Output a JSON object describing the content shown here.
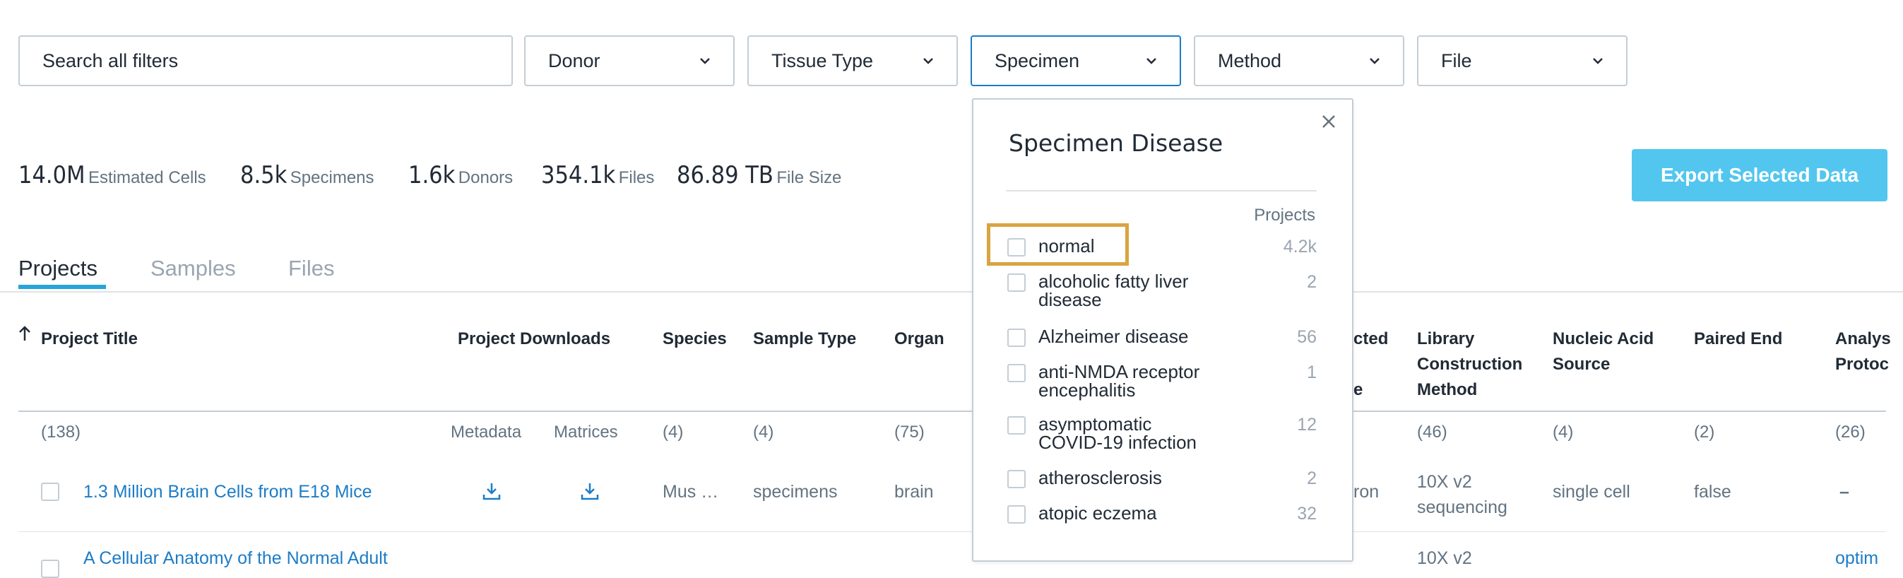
{
  "filters": {
    "search_placeholder": "Search all filters",
    "dropdowns": [
      "Donor",
      "Tissue Type",
      "Specimen",
      "Method",
      "File"
    ],
    "active": "Specimen"
  },
  "summary": [
    {
      "value": "14.0M",
      "label": "Estimated Cells"
    },
    {
      "value": "8.5k",
      "label": "Specimens"
    },
    {
      "value": "1.6k",
      "label": "Donors"
    },
    {
      "value": "354.1k",
      "label": "Files"
    },
    {
      "value": "86.89 TB",
      "label": "File Size"
    }
  ],
  "export_label": "Export Selected Data",
  "tabs": [
    "Projects",
    "Samples",
    "Files"
  ],
  "table": {
    "headers": {
      "project_title": "Project Title",
      "project_downloads": "Project Downloads",
      "species": "Species",
      "sample_type": "Sample Type",
      "organ": "Organ",
      "selected_cell_type_partial": "cted",
      "selected_cell_type_partial2": "e",
      "library_l1": "Library",
      "library_l2": "Construction",
      "library_l3": "Method",
      "nucleic_l1": "Nucleic Acid",
      "nucleic_l2": "Source",
      "paired_end": "Paired End",
      "analysis_l1": "Analys",
      "analysis_l2": "Protoc"
    },
    "counts": {
      "project_title": "(138)",
      "metadata": "Metadata",
      "matrices": "Matrices",
      "species": "(4)",
      "sample_type": "(4)",
      "organ": "(75)",
      "library": "(46)",
      "nucleic": "(4)",
      "paired_end": "(2)",
      "analysis": "(26)"
    },
    "rows": [
      {
        "title": "1.3 Million Brain Cells from E18 Mice",
        "species": "Mus …",
        "sample_type": "specimens",
        "organ": "brain",
        "selected_partial": "ron",
        "library_l1": "10X v2",
        "library_l2": "sequencing",
        "nucleic": "single cell",
        "paired_end": "false",
        "analysis": "–"
      },
      {
        "title": "A Cellular Anatomy of the Normal Adult",
        "library_l1": "10X v2",
        "analysis": "optim"
      }
    ]
  },
  "popup": {
    "title": "Specimen Disease",
    "column_header": "Projects",
    "options": [
      {
        "label": [
          "normal"
        ],
        "count": "4.2k"
      },
      {
        "label": [
          "alcoholic fatty liver",
          "disease"
        ],
        "count": "2"
      },
      {
        "label": [
          "Alzheimer disease"
        ],
        "count": "56"
      },
      {
        "label": [
          "anti-NMDA receptor",
          "encephalitis"
        ],
        "count": "1"
      },
      {
        "label": [
          "asymptomatic",
          "COVID-19 infection"
        ],
        "count": "12"
      },
      {
        "label": [
          "atherosclerosis"
        ],
        "count": "2"
      },
      {
        "label": [
          "atopic eczema"
        ],
        "count": "32"
      }
    ]
  },
  "colors": {
    "accent": "#1c7cc7",
    "export": "#52c6ef",
    "highlight": "#d9a441",
    "tab_underline": "#28a4d9"
  }
}
